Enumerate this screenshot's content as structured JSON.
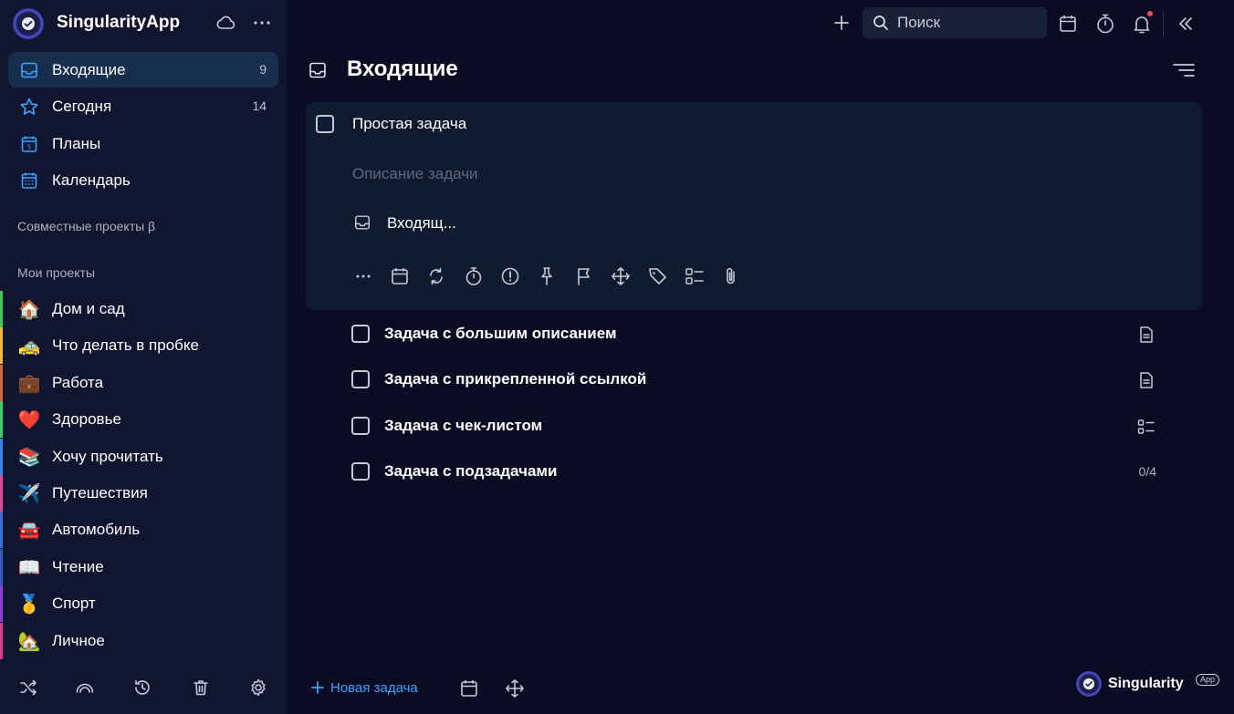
{
  "app": {
    "name": "SingularityApp",
    "brand_name": "Singularity",
    "brand_badge": "App"
  },
  "nav": [
    {
      "label": "Входящие",
      "count": "9",
      "icon": "inbox-icon",
      "active": true
    },
    {
      "label": "Сегодня",
      "count": "14",
      "icon": "star-icon"
    },
    {
      "label": "Планы",
      "count": "",
      "icon": "plans-calendar-icon"
    },
    {
      "label": "Календарь",
      "count": "",
      "icon": "calendar-icon"
    }
  ],
  "sections": {
    "shared": "Совместные проекты β",
    "mine": "Мои проекты"
  },
  "projects": [
    {
      "label": "Дом и сад",
      "emoji": "🏠",
      "color": "#43c75a"
    },
    {
      "label": "Что делать в пробке",
      "emoji": "🚕",
      "color": "#f4b63b"
    },
    {
      "label": "Работа",
      "emoji": "💼",
      "color": "#d46a3a"
    },
    {
      "label": "Здоровье",
      "emoji": "❤️",
      "color": "#3fcf6a"
    },
    {
      "label": "Хочу прочитать",
      "emoji": "📚",
      "color": "#3a84e8"
    },
    {
      "label": "Путешествия",
      "emoji": "✈️",
      "color": "#e0499a"
    },
    {
      "label": "Автомобиль",
      "emoji": "🚘",
      "color": "#3b6fd6"
    },
    {
      "label": "Чтение",
      "emoji": "📖",
      "color": "#2f5fb8"
    },
    {
      "label": "Спорт",
      "emoji": "🥇",
      "color": "#8a3fd6"
    },
    {
      "label": "Личное",
      "emoji": "🏡",
      "color": "#d6408a"
    }
  ],
  "search": {
    "placeholder": "Поиск"
  },
  "page": {
    "title": "Входящие"
  },
  "editing_task": {
    "title": "Простая задача",
    "description_placeholder": "Описание задачи",
    "project": "Входящ..."
  },
  "tasks": [
    {
      "label": "Задача с большим описанием",
      "meta": "note-icon",
      "count": ""
    },
    {
      "label": "Задача с прикрепленной ссылкой",
      "meta": "note-icon",
      "count": ""
    },
    {
      "label": "Задача с чек-листом",
      "meta": "checklist-icon",
      "count": ""
    },
    {
      "label": "Задача с подзадачами",
      "meta": "",
      "count": "0/4"
    }
  ],
  "footer": {
    "new_task": "Новая задача"
  },
  "colors": {
    "background": "#0b0b24",
    "sidebar": "#10162f",
    "active_nav": "#172e4d",
    "accent": "#3ba4ff",
    "notification_dot": "#ef4d4d"
  }
}
